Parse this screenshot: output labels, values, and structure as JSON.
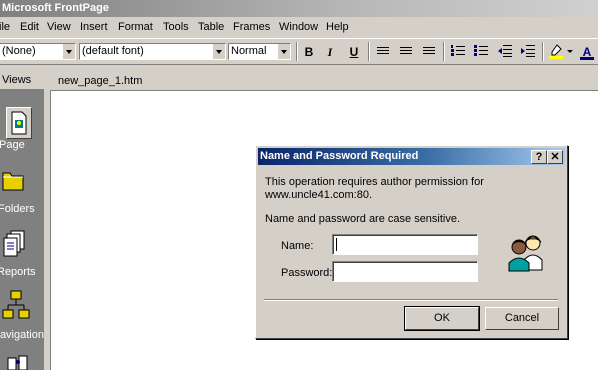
{
  "app": {
    "title": "Microsoft FrontPage"
  },
  "menu": [
    "ile",
    "Edit",
    "View",
    "Insert",
    "Format",
    "Tools",
    "Table",
    "Frames",
    "Window",
    "Help"
  ],
  "toolbar": {
    "style": "(None)",
    "font": "(default font)",
    "size": "Normal",
    "bold": "B",
    "italic": "I",
    "underline": "U",
    "font_color_glyph": "A"
  },
  "views": {
    "header": "Views",
    "items": [
      "Page",
      "Folders",
      "Reports",
      "Navigation"
    ]
  },
  "editor": {
    "tab": "new_page_1.htm"
  },
  "dialog": {
    "title": "Name and Password Required",
    "help_glyph": "?",
    "close_glyph": "✕",
    "message_line1": "This operation requires author permission for",
    "message_line2": "www.uncle41.com:80.",
    "case_note": "Name and password are case sensitive.",
    "name_label": "Name:",
    "name_value": "",
    "password_label": "Password:",
    "password_value": "",
    "ok_label": "OK",
    "cancel_label": "Cancel"
  },
  "icons": {
    "dialog_picture": "two-users-icon",
    "page_view": "page-icon",
    "folders_view": "folder-icon",
    "reports_view": "reports-icon",
    "navigation_view": "navigation-icon"
  }
}
